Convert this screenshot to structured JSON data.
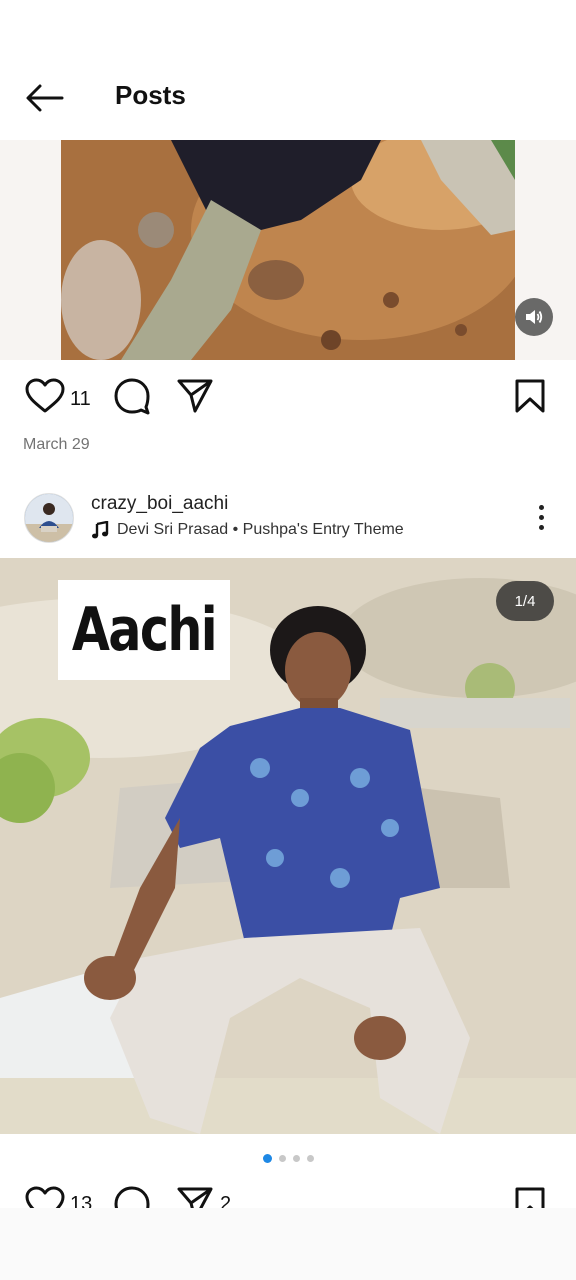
{
  "header": {
    "title": "Posts"
  },
  "post1": {
    "likes": "11",
    "date": "March 29"
  },
  "post2": {
    "username": "crazy_boi_aachi",
    "music": "Devi Sri Prasad • Pushpa's Entry Theme",
    "caption_overlay": "Aachi",
    "page_indicator": "1/4",
    "carousel_total": 4,
    "carousel_active": 1,
    "likes": "13",
    "shares": "2"
  },
  "colors": {
    "accent": "#1e88e5",
    "muted": "#737373"
  },
  "icons": [
    "back-arrow-icon",
    "speaker-icon",
    "heart-icon",
    "comment-icon",
    "send-icon",
    "bookmark-icon",
    "music-note-icon",
    "more-icon"
  ]
}
